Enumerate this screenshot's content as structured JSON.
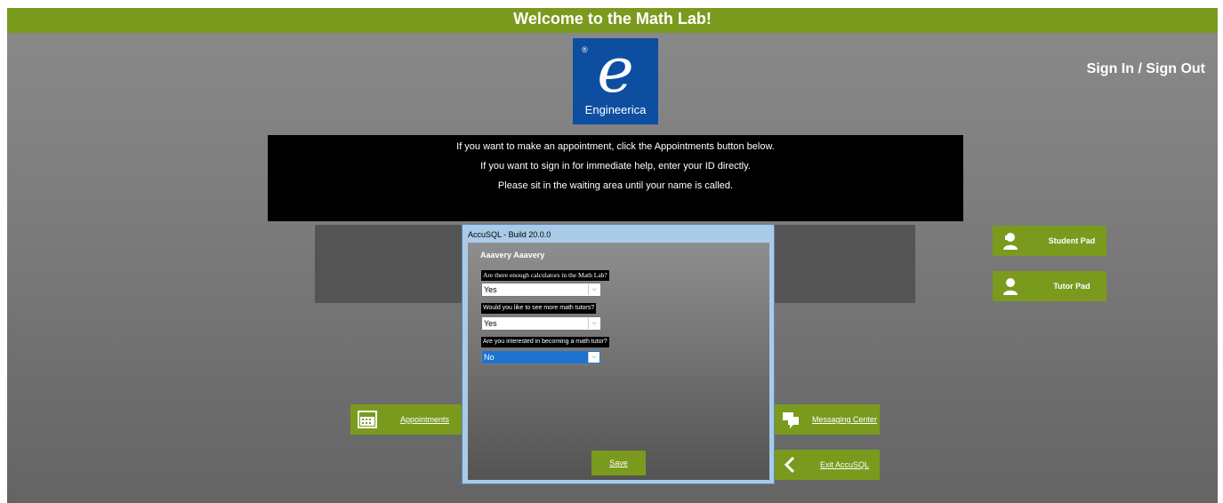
{
  "header": {
    "title": "Welcome to the Math Lab!",
    "sign_in_out": "Sign In / Sign Out"
  },
  "logo": {
    "registered": "®",
    "mark": "e",
    "wordmark": "Engineerica"
  },
  "info": [
    "If you want to make an appointment, click the Appointments button below.",
    "If you want to sign in for immediate help, enter your ID directly.",
    "Please sit in the waiting area until your name is called."
  ],
  "side_buttons": {
    "student_pad": "Student Pad",
    "tutor_pad": "Tutor Pad"
  },
  "main_buttons": {
    "appointments": "Appointments",
    "messaging_center": "Messaging Center",
    "exit": "Exit AccuSQL"
  },
  "dialog": {
    "title": "AccuSQL - Build 20.0.0",
    "user": "Aaavery Aaavery",
    "questions": [
      {
        "label": "Are there enough calculators in the Math Lab?",
        "value": "Yes"
      },
      {
        "label": "Would you like to see more math tutors?",
        "value": "Yes"
      },
      {
        "label": "Are you interested in becoming a math tutor?",
        "value": "No"
      }
    ],
    "save_label": "Save"
  },
  "colors": {
    "accent_green": "#7a9a1e",
    "logo_blue": "#0d4ea1",
    "dialog_frame": "#a9cbe8"
  }
}
